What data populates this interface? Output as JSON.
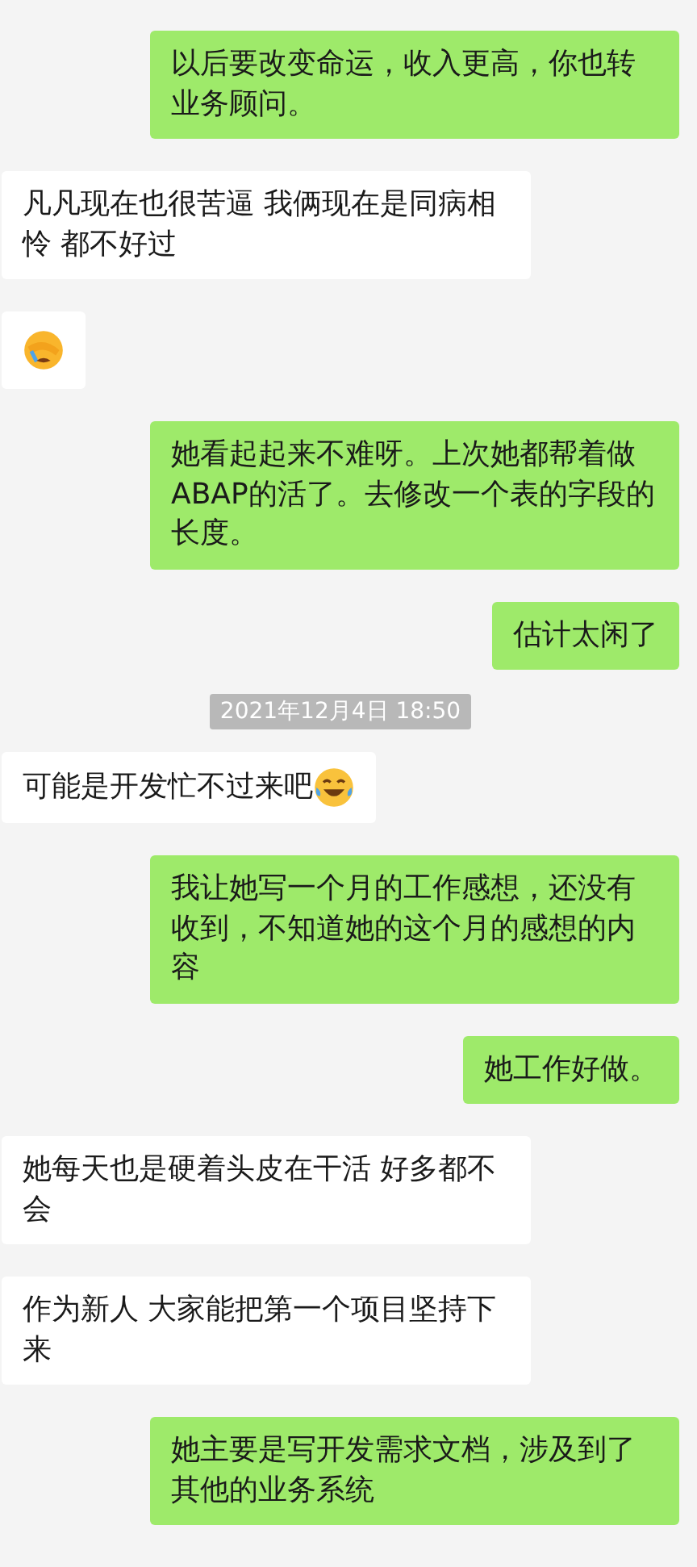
{
  "messages": [
    {
      "kind": "sent",
      "text": "以后要改变命运，收入更高，你也转业务顾问。"
    },
    {
      "kind": "received",
      "text": "凡凡现在也很苦逼 我俩现在是同病相怜 都不好过"
    },
    {
      "kind": "received",
      "emoji": {
        "kind": "facepalm"
      }
    },
    {
      "kind": "sent",
      "text": "她看起起来不难呀。上次她都帮着做ABAP的活了。去修改一个表的字段的长度。"
    },
    {
      "kind": "sent",
      "text": "估计太闲了"
    },
    {
      "kind": "time",
      "text": "2021年12月4日 18:50"
    },
    {
      "kind": "received",
      "text": "可能是开发忙不过来吧",
      "emoji": {
        "kind": "laugh"
      }
    },
    {
      "kind": "sent",
      "text": "我让她写一个月的工作感想，还没有收到，不知道她的这个月的感想的内容"
    },
    {
      "kind": "sent",
      "text": "她工作好做。"
    },
    {
      "kind": "received",
      "text": "她每天也是硬着头皮在干活 好多都不会"
    },
    {
      "kind": "received",
      "text": "作为新人 大家能把第一个项目坚持下来"
    },
    {
      "kind": "sent",
      "text": "她主要是写开发需求文档，涉及到了其他的业务系统"
    }
  ]
}
